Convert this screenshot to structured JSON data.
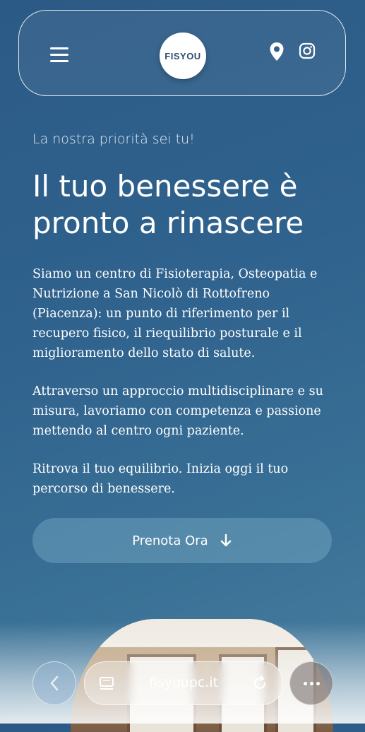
{
  "header": {
    "logo_text": "FISYOU",
    "icons": [
      "menu-icon",
      "location-pin-icon",
      "instagram-icon"
    ]
  },
  "hero": {
    "eyebrow": "La nostra priorità sei tu!",
    "headline": "Il tuo benessere è pronto a rinascere",
    "paragraphs": [
      "Siamo un centro di Fisioterapia, Osteopatia e Nutrizione a San Nicolò di Rottofreno (Piacenza): un punto di riferimento per il recupero fisico, il riequilibrio posturale e il miglioramento dello stato di salute.",
      "Attraverso un approccio multidisciplinare e su misura, lavoriamo con competenza e passione mettendo al centro ogni paziente.",
      "Ritrova il tuo equilibrio. Inizia oggi il tuo percorso di benessere."
    ],
    "cta_label": "Prenota Ora"
  },
  "browser": {
    "url": "fisyoupc.it",
    "icons": [
      "back-chevron-icon",
      "tabs-icon",
      "reload-icon",
      "more-dots-icon"
    ]
  },
  "colors": {
    "background_top": "#2c5a86",
    "background_bottom": "#4a7f9f",
    "logo_text": "#2c4f6f"
  }
}
